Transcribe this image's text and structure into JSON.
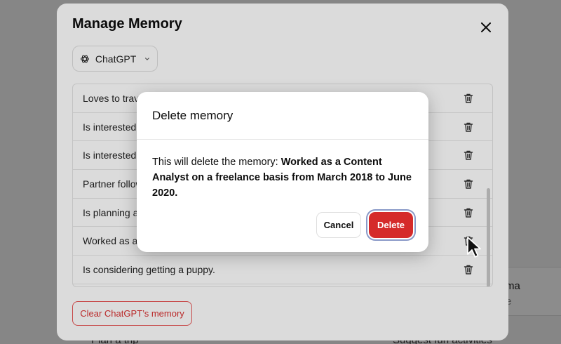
{
  "background": {
    "card_title": "ma",
    "card_subtitle": "e",
    "bottom_left_text": "Plan a trip",
    "bottom_right_text": "Suggest fun activities"
  },
  "manage_memory": {
    "title": "Manage Memory",
    "model_selector": {
      "label": "ChatGPT",
      "icon": "openai-logo-icon",
      "chevron": "chevron-down-icon"
    },
    "memories": [
      "Loves to trave",
      "Is interested i",
      "Is interested i",
      "Partner follow",
      "Is planning a t",
      "Worked as a C",
      "Is considering getting a puppy."
    ],
    "clear_button": "Clear ChatGPT’s memory",
    "close_icon": "close-icon"
  },
  "delete_dialog": {
    "title": "Delete memory",
    "body_prefix": "This will delete the memory: ",
    "body_memory": "Worked as a Content Analyst on a freelance basis from March 2018 to June 2020.",
    "cancel_label": "Cancel",
    "delete_label": "Delete"
  },
  "colors": {
    "danger": "#d52a2a",
    "danger_outline": "#e85555",
    "focus_ring": "#8a9ac8"
  }
}
